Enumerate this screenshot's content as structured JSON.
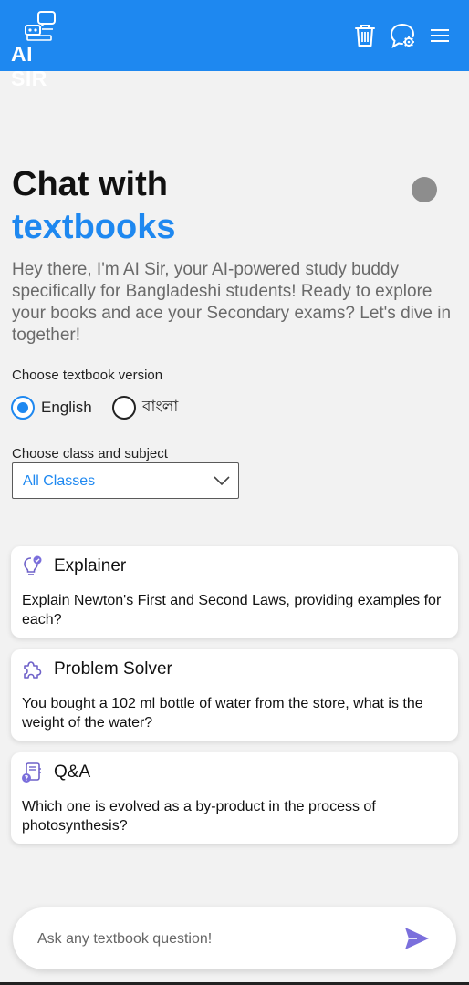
{
  "header": {
    "logo_text": "AI SIR",
    "icons": [
      "robot-logo-icon",
      "trash-icon",
      "chat-settings-icon",
      "hamburger-menu-icon"
    ],
    "brand_color": "#1e88f0"
  },
  "hero": {
    "title_line1": "Chat with",
    "title_line2": "textbooks",
    "intro": "Hey there, I'm AI Sir, your AI-powered study buddy specifically for Bangladeshi students! Ready to explore your books and ace your Secondary exams? Let's dive in together!"
  },
  "version": {
    "label": "Choose textbook version",
    "options": [
      "English",
      "বাংলা"
    ],
    "selected": "English"
  },
  "class_subject": {
    "label": "Choose class and subject",
    "selected": "All Classes"
  },
  "cards": [
    {
      "icon": "lightbulb-check-icon",
      "title": "Explainer",
      "text": "Explain Newton's First and Second Laws, providing examples for each?"
    },
    {
      "icon": "puzzle-piece-icon",
      "title": "Problem Solver",
      "text": "You bought a 102 ml bottle of water from the store, what is the weight of the water?"
    },
    {
      "icon": "book-question-icon",
      "title": "Q&A",
      "text": "Which one is evolved as a by-product in the process of photosynthesis?"
    }
  ],
  "ask": {
    "placeholder": "Ask any textbook question!",
    "send_icon": "send-icon",
    "send_color": "#7b6fdc"
  }
}
